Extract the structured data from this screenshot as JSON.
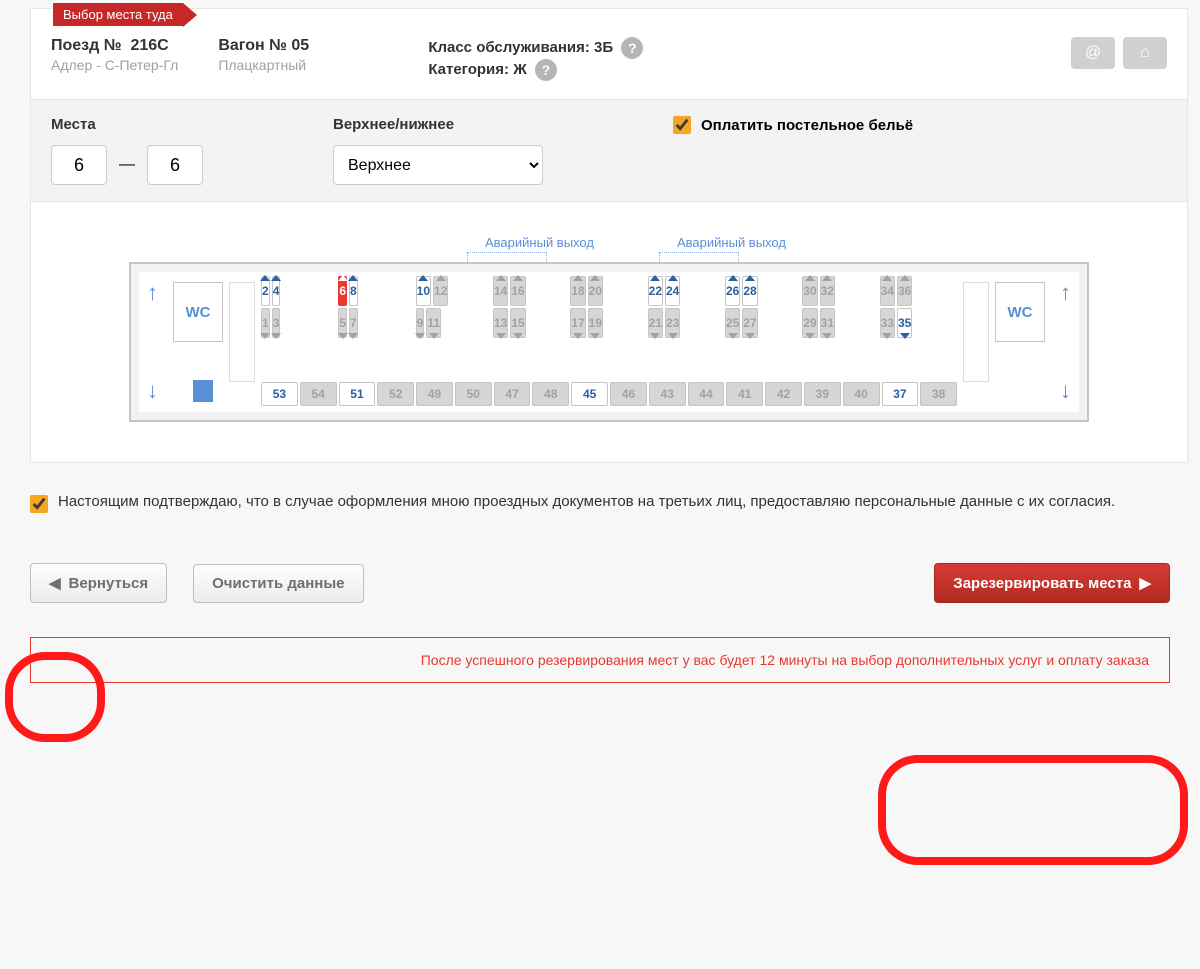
{
  "ribbon": "Выбор места туда",
  "train": {
    "label": "Поезд №",
    "num": "216С",
    "route": "Адлер - С-Петер-Гл"
  },
  "wagon": {
    "label": "Вагон № 05",
    "type": "Плацкартный"
  },
  "service": {
    "class_label": "Класс обслуживания:",
    "class_val": "3Б",
    "cat_label": "Категория:",
    "cat_val": "Ж"
  },
  "filters": {
    "seats_label": "Места",
    "from": "6",
    "to": "6",
    "dash": "—",
    "level_label": "Верхнее/нижнее",
    "level_val": "Верхнее",
    "linen_label": "Оплатить постельное бельё"
  },
  "exits": {
    "label": "Аварийный выход"
  },
  "wc": "WC",
  "compartments": [
    {
      "top": [
        {
          "n": 2,
          "s": "avail"
        },
        {
          "n": 4,
          "s": "avail"
        }
      ],
      "bot": [
        {
          "n": 1,
          "s": "taken"
        },
        {
          "n": 3,
          "s": "taken"
        }
      ]
    },
    {
      "top": [
        {
          "n": 6,
          "s": "selected"
        },
        {
          "n": 8,
          "s": "avail"
        }
      ],
      "bot": [
        {
          "n": 5,
          "s": "taken"
        },
        {
          "n": 7,
          "s": "taken"
        }
      ]
    },
    {
      "top": [
        {
          "n": 10,
          "s": "avail"
        },
        {
          "n": 12,
          "s": "taken"
        }
      ],
      "bot": [
        {
          "n": 9,
          "s": "taken"
        },
        {
          "n": 11,
          "s": "taken"
        }
      ]
    },
    {
      "top": [
        {
          "n": 14,
          "s": "taken"
        },
        {
          "n": 16,
          "s": "taken"
        }
      ],
      "bot": [
        {
          "n": 13,
          "s": "taken"
        },
        {
          "n": 15,
          "s": "taken"
        }
      ]
    },
    {
      "top": [
        {
          "n": 18,
          "s": "taken"
        },
        {
          "n": 20,
          "s": "taken"
        }
      ],
      "bot": [
        {
          "n": 17,
          "s": "taken"
        },
        {
          "n": 19,
          "s": "taken"
        }
      ]
    },
    {
      "top": [
        {
          "n": 22,
          "s": "avail"
        },
        {
          "n": 24,
          "s": "avail"
        }
      ],
      "bot": [
        {
          "n": 21,
          "s": "taken"
        },
        {
          "n": 23,
          "s": "taken"
        }
      ]
    },
    {
      "top": [
        {
          "n": 26,
          "s": "avail"
        },
        {
          "n": 28,
          "s": "avail"
        }
      ],
      "bot": [
        {
          "n": 25,
          "s": "taken"
        },
        {
          "n": 27,
          "s": "taken"
        }
      ]
    },
    {
      "top": [
        {
          "n": 30,
          "s": "taken"
        },
        {
          "n": 32,
          "s": "taken"
        }
      ],
      "bot": [
        {
          "n": 29,
          "s": "taken"
        },
        {
          "n": 31,
          "s": "taken"
        }
      ]
    },
    {
      "top": [
        {
          "n": 34,
          "s": "taken"
        },
        {
          "n": 36,
          "s": "taken"
        }
      ],
      "bot": [
        {
          "n": 33,
          "s": "taken"
        },
        {
          "n": 35,
          "s": "avail"
        }
      ]
    }
  ],
  "sides": [
    {
      "n": 53,
      "s": "avail"
    },
    {
      "n": 54,
      "s": "taken"
    },
    {
      "n": 51,
      "s": "avail"
    },
    {
      "n": 52,
      "s": "taken"
    },
    {
      "n": 49,
      "s": "taken"
    },
    {
      "n": 50,
      "s": "taken"
    },
    {
      "n": 47,
      "s": "taken"
    },
    {
      "n": 48,
      "s": "taken"
    },
    {
      "n": 45,
      "s": "avail"
    },
    {
      "n": 46,
      "s": "taken"
    },
    {
      "n": 43,
      "s": "taken"
    },
    {
      "n": 44,
      "s": "taken"
    },
    {
      "n": 41,
      "s": "taken"
    },
    {
      "n": 42,
      "s": "taken"
    },
    {
      "n": 39,
      "s": "taken"
    },
    {
      "n": 40,
      "s": "taken"
    },
    {
      "n": 37,
      "s": "avail"
    },
    {
      "n": 38,
      "s": "taken"
    }
  ],
  "consent": "Настоящим подтверждаю, что в случае оформления мною проездных документов на третьих лиц, предоставляю персональные данные с их согласия.",
  "btns": {
    "back": "Вернуться",
    "clear": "Очистить данные",
    "reserve": "Зарезервировать места"
  },
  "info": "После успешного резервирования мест у вас будет 12 минуты на выбор дополнительных услуг и оплату заказа"
}
